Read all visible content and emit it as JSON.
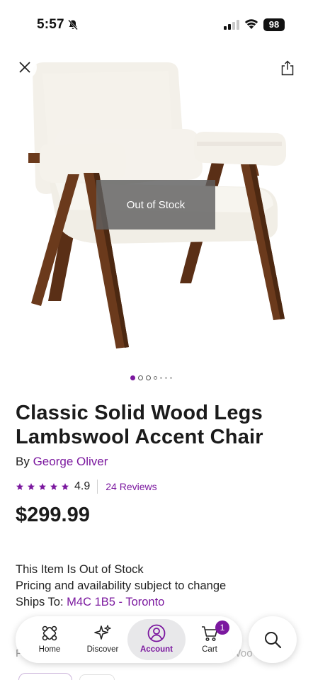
{
  "status_bar": {
    "time": "5:57",
    "battery": "98",
    "icons": [
      "bell-off-icon",
      "signal-icon",
      "wifi-icon",
      "battery-icon"
    ]
  },
  "hero": {
    "overlay_text": "Out of Stock",
    "image_count": 7,
    "current_image": 1
  },
  "product": {
    "title": "Classic Solid Wood Legs Lambswool Accent Chair",
    "by_label": "By",
    "brand": "George Oliver",
    "rating": "4.9",
    "rating_fraction": 0.98,
    "reviews": "24 Reviews",
    "price": "$299.99"
  },
  "stock": {
    "status": "This Item Is Out of Stock",
    "note": "Pricing and availability subject to change",
    "ships_label": "Ships To:",
    "ships_location": "M4C 1B5 - Toronto"
  },
  "bottom_nav": {
    "items": [
      {
        "label": "Home",
        "icon": "home-icon"
      },
      {
        "label": "Discover",
        "icon": "sparkle-icon"
      },
      {
        "label": "Account",
        "icon": "account-icon",
        "active": true
      },
      {
        "label": "Cart",
        "icon": "cart-icon",
        "badge": "1"
      }
    ],
    "search_icon": "search-icon"
  },
  "colors": {
    "accent": "#7b189f",
    "text": "#1b1b1b",
    "overlay": "#5f5f5f",
    "wood": "#6b3a1c",
    "fabric": "#f4f1ea"
  }
}
